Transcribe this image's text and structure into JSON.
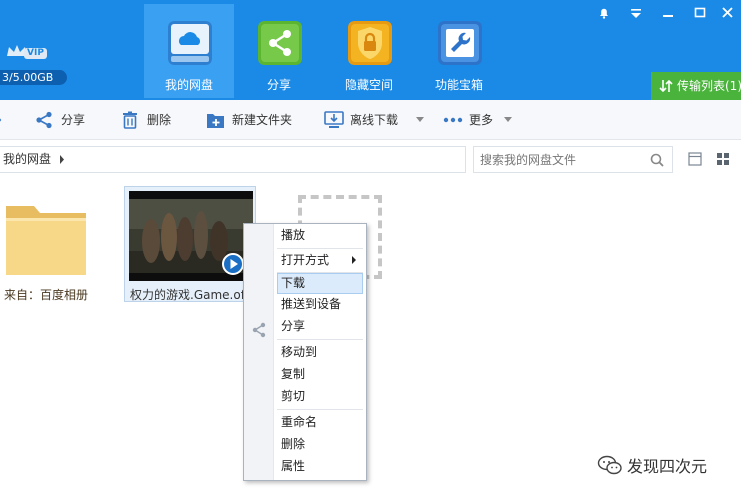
{
  "header": {
    "vip_label": "VIP",
    "quota": "3/5.00GB",
    "tabs": [
      {
        "label": "我的网盘",
        "icon": "cloud-icon",
        "active": true
      },
      {
        "label": "分享",
        "icon": "share-icon",
        "active": false
      },
      {
        "label": "隐藏空间",
        "icon": "lock-shield-icon",
        "active": false
      },
      {
        "label": "功能宝箱",
        "icon": "wrench-icon",
        "active": false
      }
    ],
    "transfer_list": "传输列表(1)",
    "colors": {
      "header": "#1a8ae6",
      "active_tab": "#3aa0f2",
      "transfer": "#4ab33c"
    }
  },
  "toolbar": {
    "share": "分享",
    "delete": "删除",
    "new_folder": "新建文件夹",
    "offline_download": "离线下载",
    "more": "更多"
  },
  "address": {
    "path": "我的网盘",
    "search_placeholder": "搜索我的网盘文件"
  },
  "files": [
    {
      "name": "来自：百度相册",
      "type": "folder"
    },
    {
      "name": "权力的游戏.Game.of",
      "type": "video"
    }
  ],
  "context_menu": {
    "items": [
      {
        "label": "播放"
      },
      {
        "label": "打开方式",
        "submenu": true
      },
      {
        "label": "下载",
        "hover": true
      },
      {
        "label": "推送到设备"
      },
      {
        "label": "分享"
      },
      {
        "label": "移动到"
      },
      {
        "label": "复制"
      },
      {
        "label": "剪切"
      },
      {
        "label": "重命名"
      },
      {
        "label": "删除"
      },
      {
        "label": "属性"
      }
    ]
  },
  "watermark": "发现四次元"
}
